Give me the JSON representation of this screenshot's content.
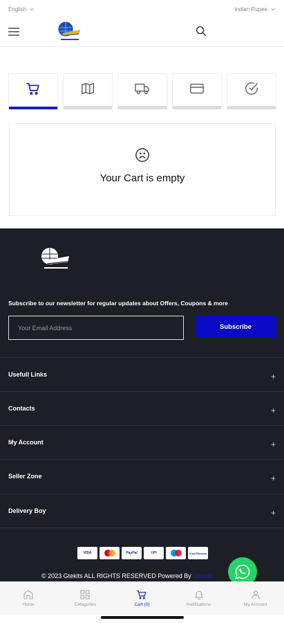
{
  "topbar": {
    "language": "English",
    "currency": "Indian Rupee"
  },
  "cart": {
    "empty_text": "Your Cart is empty"
  },
  "checkout_steps": [
    {
      "icon": "cart-icon",
      "active": true
    },
    {
      "icon": "map-icon",
      "active": false
    },
    {
      "icon": "truck-icon",
      "active": false
    },
    {
      "icon": "card-icon",
      "active": false
    },
    {
      "icon": "check-circle-icon",
      "active": false
    }
  ],
  "footer": {
    "newsletter_text": "Subscribe to our newsletter for regular updates about Offers, Coupons & more",
    "email_placeholder": "Your Email Address",
    "subscribe_label": "Subscribe",
    "sections": [
      "Usefull Links",
      "Contacts",
      "My Account",
      "Seller Zone",
      "Delivery Boy"
    ],
    "payment_methods": [
      "VISA",
      "Mastercard",
      "PayPal",
      "UPI",
      "Maestro",
      "Visa Electron"
    ],
    "copyright": "© 2023 Gtekits ALL RIGHTS RESERVED Powered By",
    "powered_link": "Gtekits"
  },
  "bottom_nav": [
    {
      "label": "Home",
      "icon": "home-icon"
    },
    {
      "label": "Categories",
      "icon": "grid-icon"
    },
    {
      "label": "Cart (0)",
      "icon": "cart-icon",
      "active": true
    },
    {
      "label": "Notifications",
      "icon": "bell-icon"
    },
    {
      "label": "My Account",
      "icon": "user-icon"
    }
  ],
  "colors": {
    "accent": "#1a1fb8",
    "footer_bg": "#1d1f26",
    "subscribe_bg": "#0a0ac4",
    "whatsapp": "#25d366"
  }
}
